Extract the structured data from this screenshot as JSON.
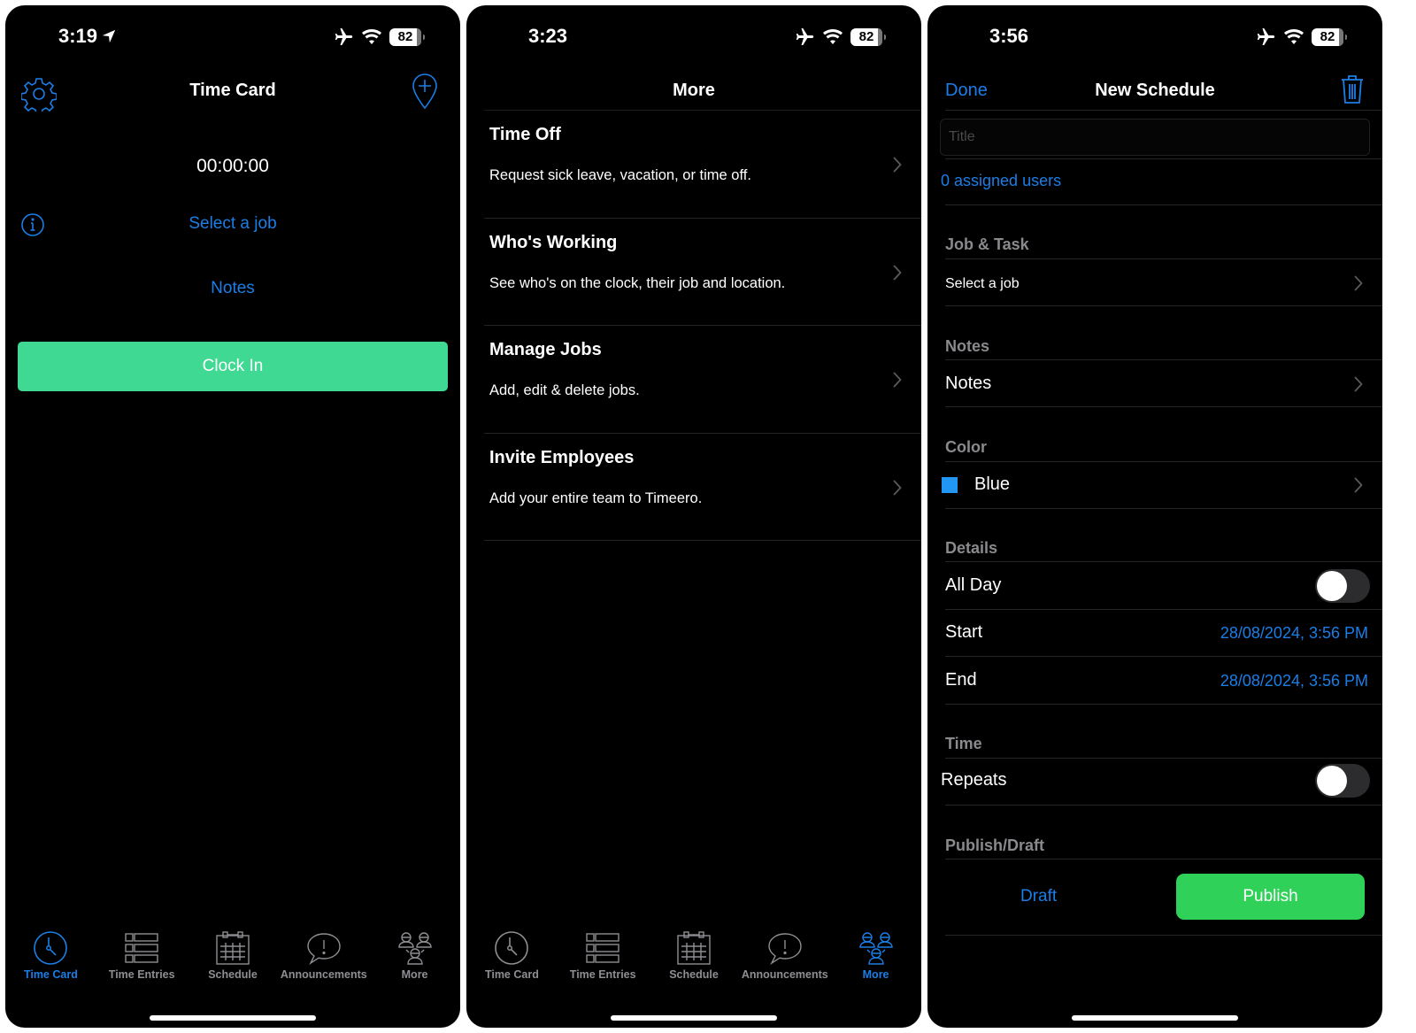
{
  "colors": {
    "accent": "#1b7ee6",
    "clock_in_green": "#3fd994",
    "publish_green": "#30d158",
    "swatch_blue": "#2196f3",
    "tab_inactive": "#8e8e93"
  },
  "status_bar": [
    {
      "time": "3:19",
      "location_arrow": true,
      "battery": "82"
    },
    {
      "time": "3:23",
      "battery": "82"
    },
    {
      "time": "3:56",
      "battery": "82"
    }
  ],
  "tabs": [
    {
      "label": "Time Card",
      "icon": "clock-icon"
    },
    {
      "label": "Time Entries",
      "icon": "list-icon"
    },
    {
      "label": "Schedule",
      "icon": "calendar-icon"
    },
    {
      "label": "Announcements",
      "icon": "speech-bubble-icon"
    },
    {
      "label": "More",
      "icon": "people-icon"
    }
  ],
  "time_card": {
    "title": "Time Card",
    "timer": "00:00:00",
    "select_job": "Select a job",
    "notes": "Notes",
    "clock_in": "Clock In",
    "active_tab": "Time Card"
  },
  "more": {
    "title": "More",
    "active_tab": "More",
    "items": [
      {
        "title": "Time Off",
        "description": "Request sick leave, vacation, or time off."
      },
      {
        "title": "Who's Working",
        "description": "See who's on the clock, their job and location."
      },
      {
        "title": "Manage Jobs",
        "description": "Add, edit & delete jobs."
      },
      {
        "title": "Invite Employees",
        "description": "Add your entire team to Timeero."
      }
    ]
  },
  "new_schedule": {
    "done": "Done",
    "title": "New Schedule",
    "title_placeholder": "Title",
    "title_value": "",
    "assigned_users": "0 assigned users",
    "sections": {
      "job_task": "Job & Task",
      "notes": "Notes",
      "color": "Color",
      "details": "Details",
      "time": "Time",
      "publish_draft": "Publish/Draft"
    },
    "select_job": "Select a job",
    "notes_row": "Notes",
    "color_value": "Blue",
    "all_day_label": "All Day",
    "all_day_on": false,
    "start_label": "Start",
    "start_value": "28/08/2024, 3:56 PM",
    "end_label": "End",
    "end_value": "28/08/2024, 3:56 PM",
    "repeats_label": "Repeats",
    "repeats_on": false,
    "draft": "Draft",
    "publish": "Publish"
  }
}
